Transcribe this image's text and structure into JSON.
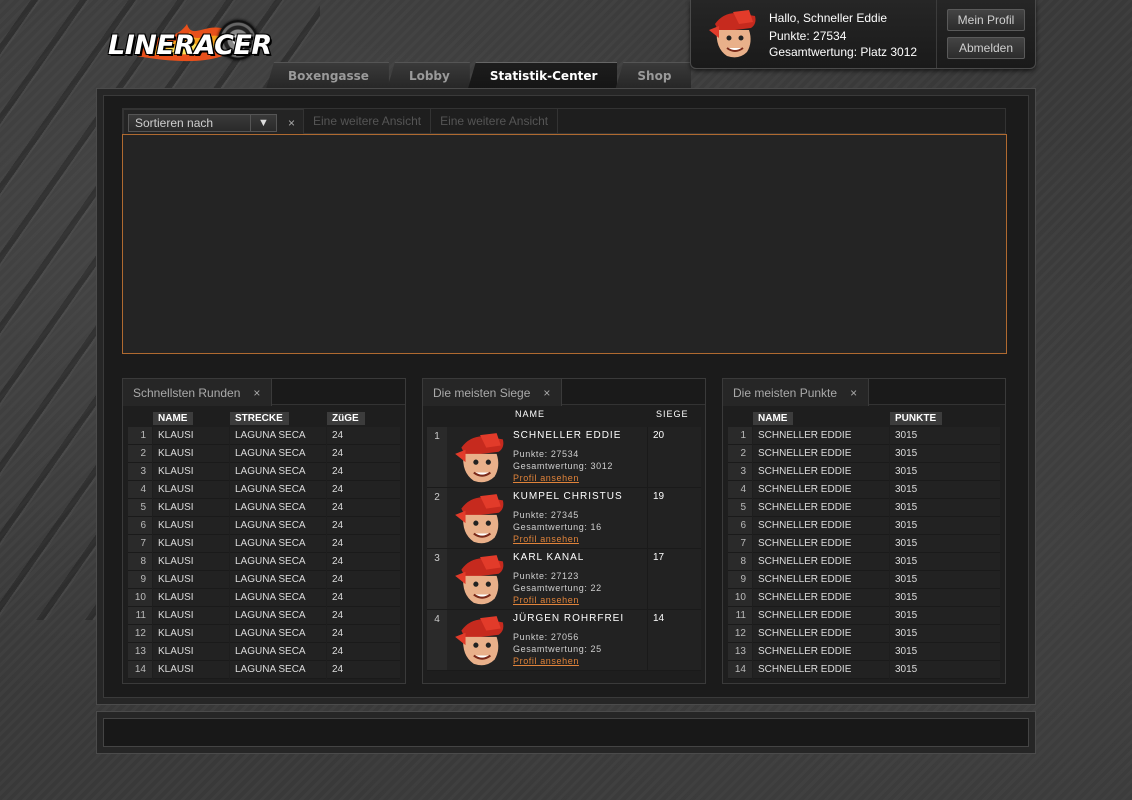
{
  "brand": {
    "logo_text": "LINERACER"
  },
  "nav": {
    "tabs": [
      {
        "label": "Boxengasse"
      },
      {
        "label": "Lobby"
      },
      {
        "label": "Statistik-Center",
        "active": true
      },
      {
        "label": "Shop"
      }
    ]
  },
  "user": {
    "greeting": "Hallo, Schneller Eddie",
    "points": "Punkte: 27534",
    "rank": "Gesamtwertung: Platz 3012",
    "profile_button": "Mein Profil",
    "logout_button": "Abmelden"
  },
  "views": {
    "sort_select": "Sortieren nach",
    "other_view_1": "Eine weitere Ansicht",
    "other_view_2": "Eine weitere Ansicht",
    "close": "×"
  },
  "fastest_laps": {
    "title": "Schnellsten Runden",
    "columns": [
      "NAME",
      "STRECKE",
      "ZüGE"
    ],
    "rows": [
      [
        "1",
        "KLAUSI",
        "LAGUNA SECA",
        "24"
      ],
      [
        "2",
        "KLAUSI",
        "LAGUNA SECA",
        "24"
      ],
      [
        "3",
        "KLAUSI",
        "LAGUNA SECA",
        "24"
      ],
      [
        "4",
        "KLAUSI",
        "LAGUNA SECA",
        "24"
      ],
      [
        "5",
        "KLAUSI",
        "LAGUNA SECA",
        "24"
      ],
      [
        "6",
        "KLAUSI",
        "LAGUNA SECA",
        "24"
      ],
      [
        "7",
        "KLAUSI",
        "LAGUNA SECA",
        "24"
      ],
      [
        "8",
        "KLAUSI",
        "LAGUNA SECA",
        "24"
      ],
      [
        "9",
        "KLAUSI",
        "LAGUNA SECA",
        "24"
      ],
      [
        "10",
        "KLAUSI",
        "LAGUNA SECA",
        "24"
      ],
      [
        "11",
        "KLAUSI",
        "LAGUNA SECA",
        "24"
      ],
      [
        "12",
        "KLAUSI",
        "LAGUNA SECA",
        "24"
      ],
      [
        "13",
        "KLAUSI",
        "LAGUNA SECA",
        "24"
      ],
      [
        "14",
        "KLAUSI",
        "LAGUNA SECA",
        "24"
      ]
    ]
  },
  "most_wins": {
    "title": "Die meisten Siege",
    "col_name": "NAME",
    "col_wins": "SIEGE",
    "rows": [
      {
        "rank": "1",
        "name": "SCHNELLER EDDIE",
        "points": "Punkte: 27534",
        "overall": "Gesamtwertung: 3012",
        "link": "Profil ansehen",
        "wins": "20"
      },
      {
        "rank": "2",
        "name": "KUMPEL CHRISTUS",
        "points": "Punkte: 27345",
        "overall": "Gesamtwertung: 16",
        "link": "Profil ansehen",
        "wins": "19"
      },
      {
        "rank": "3",
        "name": "KARL KANAL",
        "points": "Punkte: 27123",
        "overall": "Gesamtwertung: 22",
        "link": "Profil ansehen",
        "wins": "17"
      },
      {
        "rank": "4",
        "name": "JÜRGEN ROHRFREI",
        "points": "Punkte: 27056",
        "overall": "Gesamtwertung: 25",
        "link": "Profil ansehen",
        "wins": "14"
      }
    ]
  },
  "most_points": {
    "title": "Die meisten Punkte",
    "columns": [
      "NAME",
      "PUNKTE"
    ],
    "rows": [
      [
        "1",
        "SCHNELLER EDDIE",
        "3015"
      ],
      [
        "2",
        "SCHNELLER EDDIE",
        "3015"
      ],
      [
        "3",
        "SCHNELLER EDDIE",
        "3015"
      ],
      [
        "4",
        "SCHNELLER EDDIE",
        "3015"
      ],
      [
        "5",
        "SCHNELLER EDDIE",
        "3015"
      ],
      [
        "6",
        "SCHNELLER EDDIE",
        "3015"
      ],
      [
        "7",
        "SCHNELLER EDDIE",
        "3015"
      ],
      [
        "8",
        "SCHNELLER EDDIE",
        "3015"
      ],
      [
        "9",
        "SCHNELLER EDDIE",
        "3015"
      ],
      [
        "10",
        "SCHNELLER EDDIE",
        "3015"
      ],
      [
        "11",
        "SCHNELLER EDDIE",
        "3015"
      ],
      [
        "12",
        "SCHNELLER EDDIE",
        "3015"
      ],
      [
        "13",
        "SCHNELLER EDDIE",
        "3015"
      ],
      [
        "14",
        "SCHNELLER EDDIE",
        "3015"
      ]
    ]
  },
  "colors": {
    "accent": "#e0833a",
    "panel": "#1e1e1e",
    "background": "#3b3b3b"
  }
}
